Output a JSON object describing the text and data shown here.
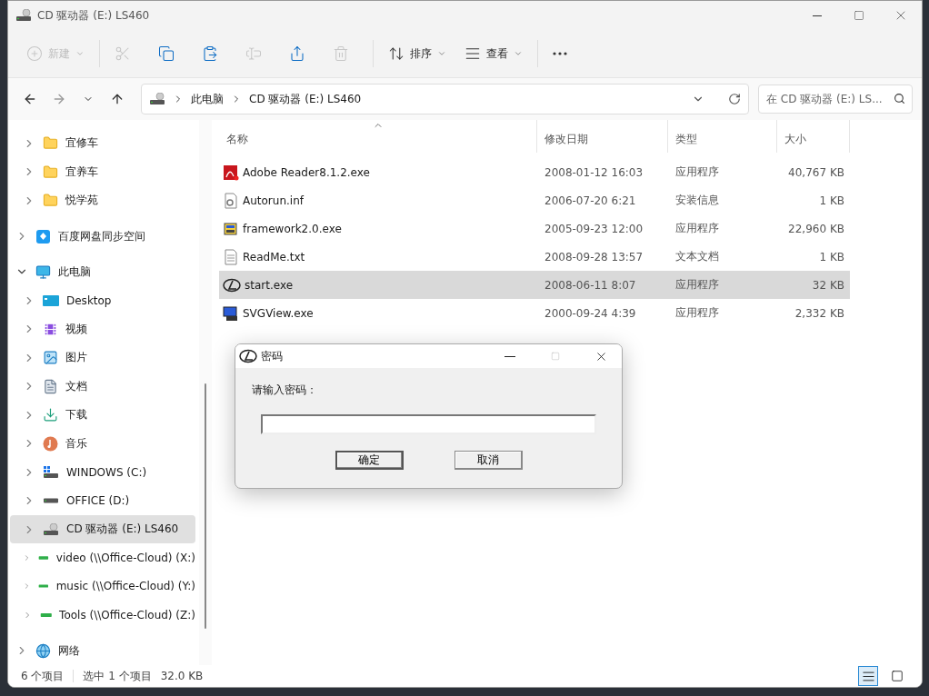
{
  "window": {
    "title": "CD 驱动器 (E:) LS460"
  },
  "toolbar": [
    {
      "kind": "new",
      "label": "新建",
      "disabled": true
    },
    {
      "kind": "cut",
      "disabled": true
    },
    {
      "kind": "copy",
      "disabled": false
    },
    {
      "kind": "paste",
      "disabled": false
    },
    {
      "kind": "rename",
      "disabled": true
    },
    {
      "kind": "share",
      "disabled": false
    },
    {
      "kind": "delete",
      "disabled": true
    },
    {
      "kind": "sort",
      "label": "排序",
      "disabled": false
    },
    {
      "kind": "view",
      "label": "查看",
      "disabled": false
    },
    {
      "kind": "more",
      "disabled": false
    }
  ],
  "address_bar": {
    "path": [
      "此电脑",
      "CD 驱动器 (E:) LS460"
    ]
  },
  "search": {
    "placeholder": "在 CD 驱动器 (E:) LS..."
  },
  "sidebar": {
    "continued_items": [
      {
        "kind": "folder",
        "label": "宜修车",
        "expanded": false,
        "selected": false
      },
      {
        "kind": "folder",
        "label": "宜养车",
        "expanded": false,
        "selected": false
      },
      {
        "kind": "folder",
        "label": "悦学苑",
        "expanded": false,
        "selected": false
      }
    ],
    "items": [
      {
        "kind": "cloud",
        "label": "百度网盘同步空间",
        "expanded": false,
        "selected": false
      },
      {
        "kind": "pc",
        "label": "此电脑",
        "expanded": true,
        "selected": false,
        "children": [
          {
            "kind": "desktop",
            "label": "Desktop",
            "expanded": false,
            "selected": false
          },
          {
            "kind": "video",
            "label": "视频",
            "expanded": false,
            "selected": false
          },
          {
            "kind": "pictures",
            "label": "图片",
            "expanded": false,
            "selected": false
          },
          {
            "kind": "documents",
            "label": "文档",
            "expanded": false,
            "selected": false
          },
          {
            "kind": "downloads",
            "label": "下载",
            "expanded": false,
            "selected": false
          },
          {
            "kind": "music",
            "label": "音乐",
            "expanded": false,
            "selected": false
          },
          {
            "kind": "windrive",
            "label": "WINDOWS (C:)",
            "expanded": false,
            "selected": false
          },
          {
            "kind": "drive",
            "label": "OFFICE (D:)",
            "expanded": false,
            "selected": false
          },
          {
            "kind": "cd",
            "label": "CD 驱动器 (E:) LS460",
            "expanded": false,
            "selected": true
          },
          {
            "kind": "netdrive",
            "label": "video (\\\\Office-Cloud) (X:)",
            "expanded": false,
            "selected": false
          },
          {
            "kind": "netdrive",
            "label": "music (\\\\Office-Cloud) (Y:)",
            "expanded": false,
            "selected": false
          },
          {
            "kind": "netdrive",
            "label": "Tools (\\\\Office-Cloud) (Z:)",
            "expanded": false,
            "selected": false
          }
        ]
      },
      {
        "kind": "network",
        "label": "网络",
        "expanded": false,
        "selected": false
      }
    ]
  },
  "table": {
    "columns": [
      {
        "label": "名称",
        "sorted": true
      },
      {
        "label": "修改日期",
        "sorted": false
      },
      {
        "label": "类型",
        "sorted": false
      },
      {
        "label": "大小",
        "sorted": false
      }
    ],
    "rows": [
      {
        "kind": "pdf",
        "name": "Adobe Reader8.1.2.exe",
        "date": "2008-01-12 16:03",
        "type": "应用程序",
        "size": "40,767 KB",
        "selected": false
      },
      {
        "kind": "config",
        "name": "Autorun.inf",
        "date": "2006-07-20 6:21",
        "type": "安装信息",
        "size": "1 KB",
        "selected": false
      },
      {
        "kind": "installer",
        "name": "framework2.0.exe",
        "date": "2005-09-23 12:00",
        "type": "应用程序",
        "size": "22,960 KB",
        "selected": false
      },
      {
        "kind": "text",
        "name": "ReadMe.txt",
        "date": "2008-09-28 13:57",
        "type": "文本文档",
        "size": "1 KB",
        "selected": false
      },
      {
        "kind": "emblem",
        "name": "start.exe",
        "date": "2008-06-11 8:07",
        "type": "应用程序",
        "size": "32 KB",
        "selected": true
      },
      {
        "kind": "app",
        "name": "SVGView.exe",
        "date": "2000-09-24 4:39",
        "type": "应用程序",
        "size": "2,332 KB",
        "selected": false
      }
    ]
  },
  "status_bar": {
    "item_count": "6 个项目",
    "selection": "选中 1 个项目",
    "selection_size": "32.0 KB",
    "views": [
      {
        "kind": "details",
        "selected": true
      },
      {
        "kind": "tiles",
        "selected": false
      }
    ]
  },
  "dialog": {
    "title": "密码",
    "prompt": "请输入密码：",
    "buttons": [
      {
        "label": "确定",
        "default": true
      },
      {
        "label": "取消",
        "default": false
      }
    ]
  }
}
